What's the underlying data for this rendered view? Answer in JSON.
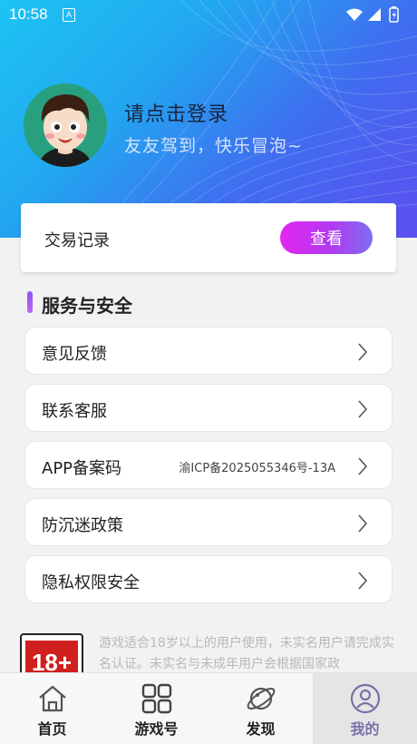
{
  "status_bar": {
    "time": "10:58",
    "notification_icon": "A"
  },
  "profile": {
    "login_prompt": "请点击登录",
    "tagline": "友友驾到，快乐冒泡~"
  },
  "trade": {
    "label": "交易记录",
    "button": "查看"
  },
  "section": {
    "title": "服务与安全"
  },
  "menu": [
    {
      "label": "意见反馈",
      "value": "",
      "icon": "chevron-right-icon"
    },
    {
      "label": "联系客服",
      "value": "",
      "icon": "chevron-right-icon"
    },
    {
      "label": "APP备案码",
      "value": "渝ICP备2025055346号-13A",
      "icon": "chevron-right-icon"
    },
    {
      "label": "防沉迷政策",
      "value": "",
      "icon": "chevron-right-icon"
    },
    {
      "label": "隐私权限安全",
      "value": "",
      "icon": "chevron-right-icon"
    }
  ],
  "notice": {
    "badge": "18+",
    "text": "游戏适合18岁以上的用户使用，未实名用户请完成实名认证。未实名与未成年用户会根据国家政"
  },
  "tabs": [
    {
      "label": "首页",
      "icon": "home-icon"
    },
    {
      "label": "游戏号",
      "icon": "grid-icon"
    },
    {
      "label": "发现",
      "icon": "planet-icon"
    },
    {
      "label": "我的",
      "icon": "user-icon",
      "active": true
    }
  ],
  "colors": {
    "hero_gradient": [
      "#1dc4f3",
      "#3f6ef0",
      "#5b4ff0"
    ],
    "button_gradient": [
      "#e426f0",
      "#7e6ef0"
    ],
    "accent_bar": "#8b57f3",
    "active_tab": "#7a70a8"
  }
}
